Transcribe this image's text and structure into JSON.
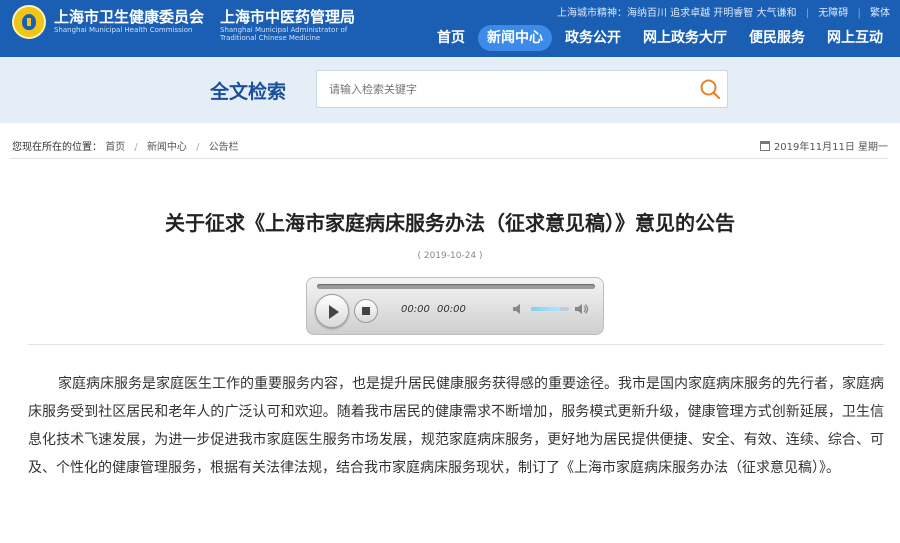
{
  "header": {
    "org1_cn": "上海市卫生健康委员会",
    "org1_en": "Shanghai Municipal Health Commission",
    "org2_cn": "上海市中医药管理局",
    "org2_en": "Shanghai Municipal Administrator of Traditional Chinese Medicine",
    "utility": {
      "slogan": "上海城市精神：海纳百川 追求卓越 开明睿智 大气谦和",
      "accessibility": "无障碍",
      "traditional": "繁体"
    },
    "nav": [
      {
        "label": "首页"
      },
      {
        "label": "新闻中心"
      },
      {
        "label": "政务公开"
      },
      {
        "label": "网上政务大厅"
      },
      {
        "label": "便民服务"
      },
      {
        "label": "网上互动"
      }
    ],
    "active_nav": "新闻中心",
    "colors": {
      "bar": "#1a5fb4",
      "active": "#3d8be8"
    }
  },
  "search": {
    "title": "全文检索",
    "placeholder": "请输入检索关键字",
    "icon": "search-icon"
  },
  "breadcrumb": {
    "label": "您现在所在的位置：",
    "items": [
      "首页",
      "新闻中心",
      "公告栏"
    ],
    "date": "2019年11月11日 星期一"
  },
  "article": {
    "title": "关于征求《上海市家庭病床服务办法（征求意见稿）》意见的公告",
    "date": "( 2019-10-24 )",
    "player": {
      "current": "00:00",
      "duration": "00:00",
      "volume": 0.75
    },
    "body": "家庭病床服务是家庭医生工作的重要服务内容，也是提升居民健康服务获得感的重要途径。我市是国内家庭病床服务的先行者，家庭病床服务受到社区居民和老年人的广泛认可和欢迎。随着我市居民的健康需求不断增加，服务模式更新升级，健康管理方式创新延展，卫生信息化技术飞速发展，为进一步促进我市家庭医生服务市场发展，规范家庭病床服务，更好地为居民提供便捷、安全、有效、连续、综合、可及、个性化的健康管理服务，根据有关法律法规，结合我市家庭病床服务现状，制订了《上海市家庭病床服务办法（征求意见稿）》。"
  }
}
